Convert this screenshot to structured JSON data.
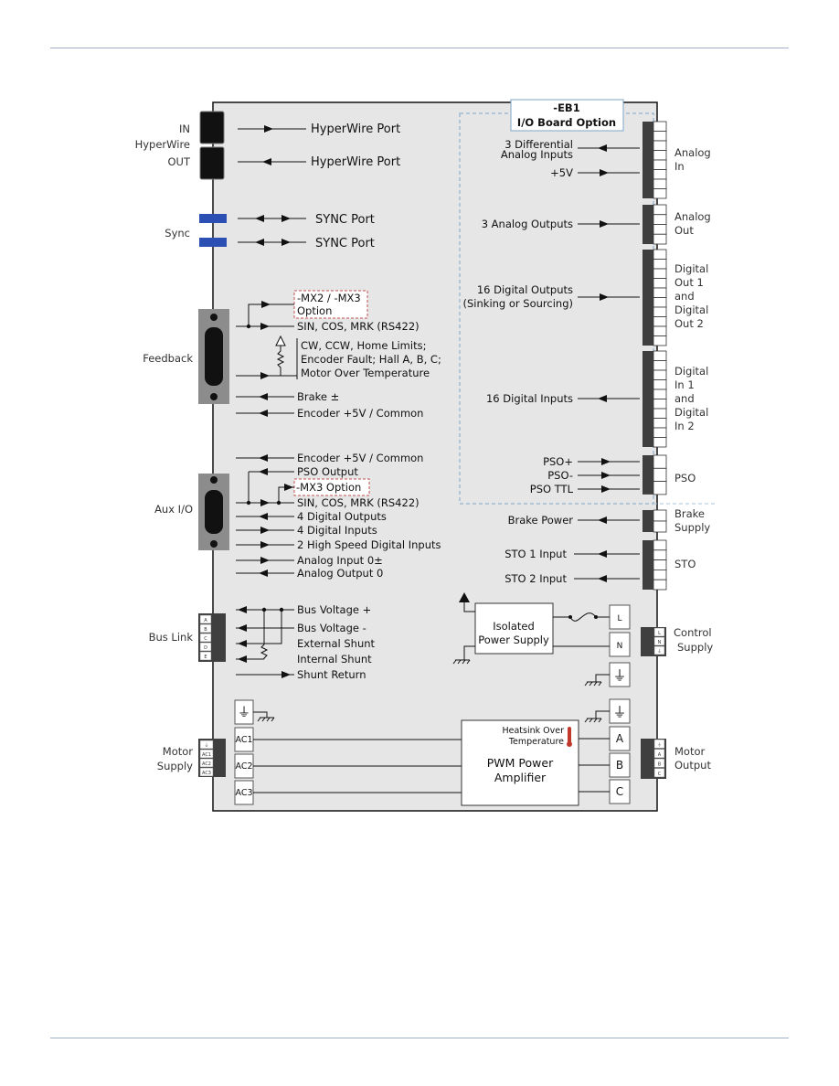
{
  "colors": {
    "board": "#e6e6e6",
    "connector_dark": "#3f3f3f",
    "connector_gray": "#8c8c8c",
    "sync_blue": "#2b4fb3",
    "eb1_border": "#7fa6c9",
    "option_border": "#c0504d",
    "thermometer": "#c0392b",
    "rule": "#9fb0cc"
  },
  "left": {
    "hyperwire": {
      "in": "IN",
      "name": "HyperWire",
      "out": "OUT",
      "port_in": "HyperWire Port",
      "port_out": "HyperWire Port"
    },
    "sync": {
      "label": "Sync",
      "port1": "SYNC Port",
      "port2": "SYNC Port"
    },
    "feedback": {
      "label": "Feedback",
      "option_line1": "-MX2 / -MX3",
      "option_line2": "Option",
      "sin_cos": "SIN, COS, MRK (RS422)",
      "limits_line1": "CW, CCW, Home Limits;",
      "limits_line2": "Encoder Fault; Hall A, B, C;",
      "limits_line3": "Motor Over Temperature",
      "brake": "Brake ±",
      "encoder": "Encoder +5V / Common"
    },
    "aux_io": {
      "label": "Aux I/O",
      "encoder": "Encoder +5V / Common",
      "pso_output": "PSO Output",
      "option": "-MX3 Option",
      "sin_cos": "SIN, COS, MRK (RS422)",
      "dig_out": "4 Digital Outputs",
      "dig_in": "4 Digital Inputs",
      "hs_in": "2 High Speed Digital Inputs",
      "analog_in": "Analog Input 0±",
      "analog_out": "Analog Output 0"
    },
    "bus_link": {
      "label": "Bus Link",
      "pins": [
        "A",
        "B",
        "C",
        "D",
        "E"
      ],
      "bus_plus": "Bus Voltage +",
      "bus_minus": "Bus Voltage -",
      "ext_shunt": "External Shunt",
      "int_shunt": "Internal Shunt",
      "shunt_return": "Shunt Return"
    },
    "motor_supply": {
      "line1": "Motor",
      "line2": "Supply",
      "pins": [
        "⏚",
        "AC1",
        "AC2",
        "AC3"
      ],
      "terminals": [
        "AC1",
        "AC2",
        "AC3"
      ]
    }
  },
  "eb1": {
    "line1": "-EB1",
    "line2": "I/O Board Option",
    "diff_in_line1": "3 Differential",
    "diff_in_line2": "Analog Inputs",
    "plus5v": "+5V",
    "analog_outputs": "3 Analog Outputs",
    "dig_out_line1": "16 Digital Outputs",
    "dig_out_line2": "(Sinking or Sourcing)",
    "dig_in": "16 Digital Inputs",
    "pso_plus": "PSO+",
    "pso_minus": "PSO-",
    "pso_ttl": "PSO TTL"
  },
  "right": {
    "analog_in": [
      "Analog",
      "In"
    ],
    "analog_out": [
      "Analog",
      "Out"
    ],
    "digital_out": [
      "Digital",
      "Out 1",
      "and",
      "Digital",
      "Out 2"
    ],
    "digital_in": [
      "Digital",
      "In 1",
      "and",
      "Digital",
      "In 2"
    ],
    "pso": "PSO",
    "brake_supply": [
      "Brake",
      "Supply"
    ],
    "sto": "STO",
    "control_supply": [
      "Control",
      "Supply"
    ],
    "control_pins": [
      "L",
      "N",
      "⏚"
    ],
    "motor_output": [
      "Motor",
      "Output"
    ],
    "motor_pins": [
      "⏚",
      "A",
      "B",
      "C"
    ],
    "brake_power": "Brake Power",
    "sto1": "STO 1 Input",
    "sto2": "STO 2 Input"
  },
  "power": {
    "psu_line1": "Isolated",
    "psu_line2": "Power Supply",
    "L": "L",
    "N": "N",
    "heatsink_line1": "Heatsink Over",
    "heatsink_line2": "Temperature",
    "pwm_line1": "PWM Power",
    "pwm_line2": "Amplifier",
    "A": "A",
    "B": "B",
    "C": "C"
  }
}
